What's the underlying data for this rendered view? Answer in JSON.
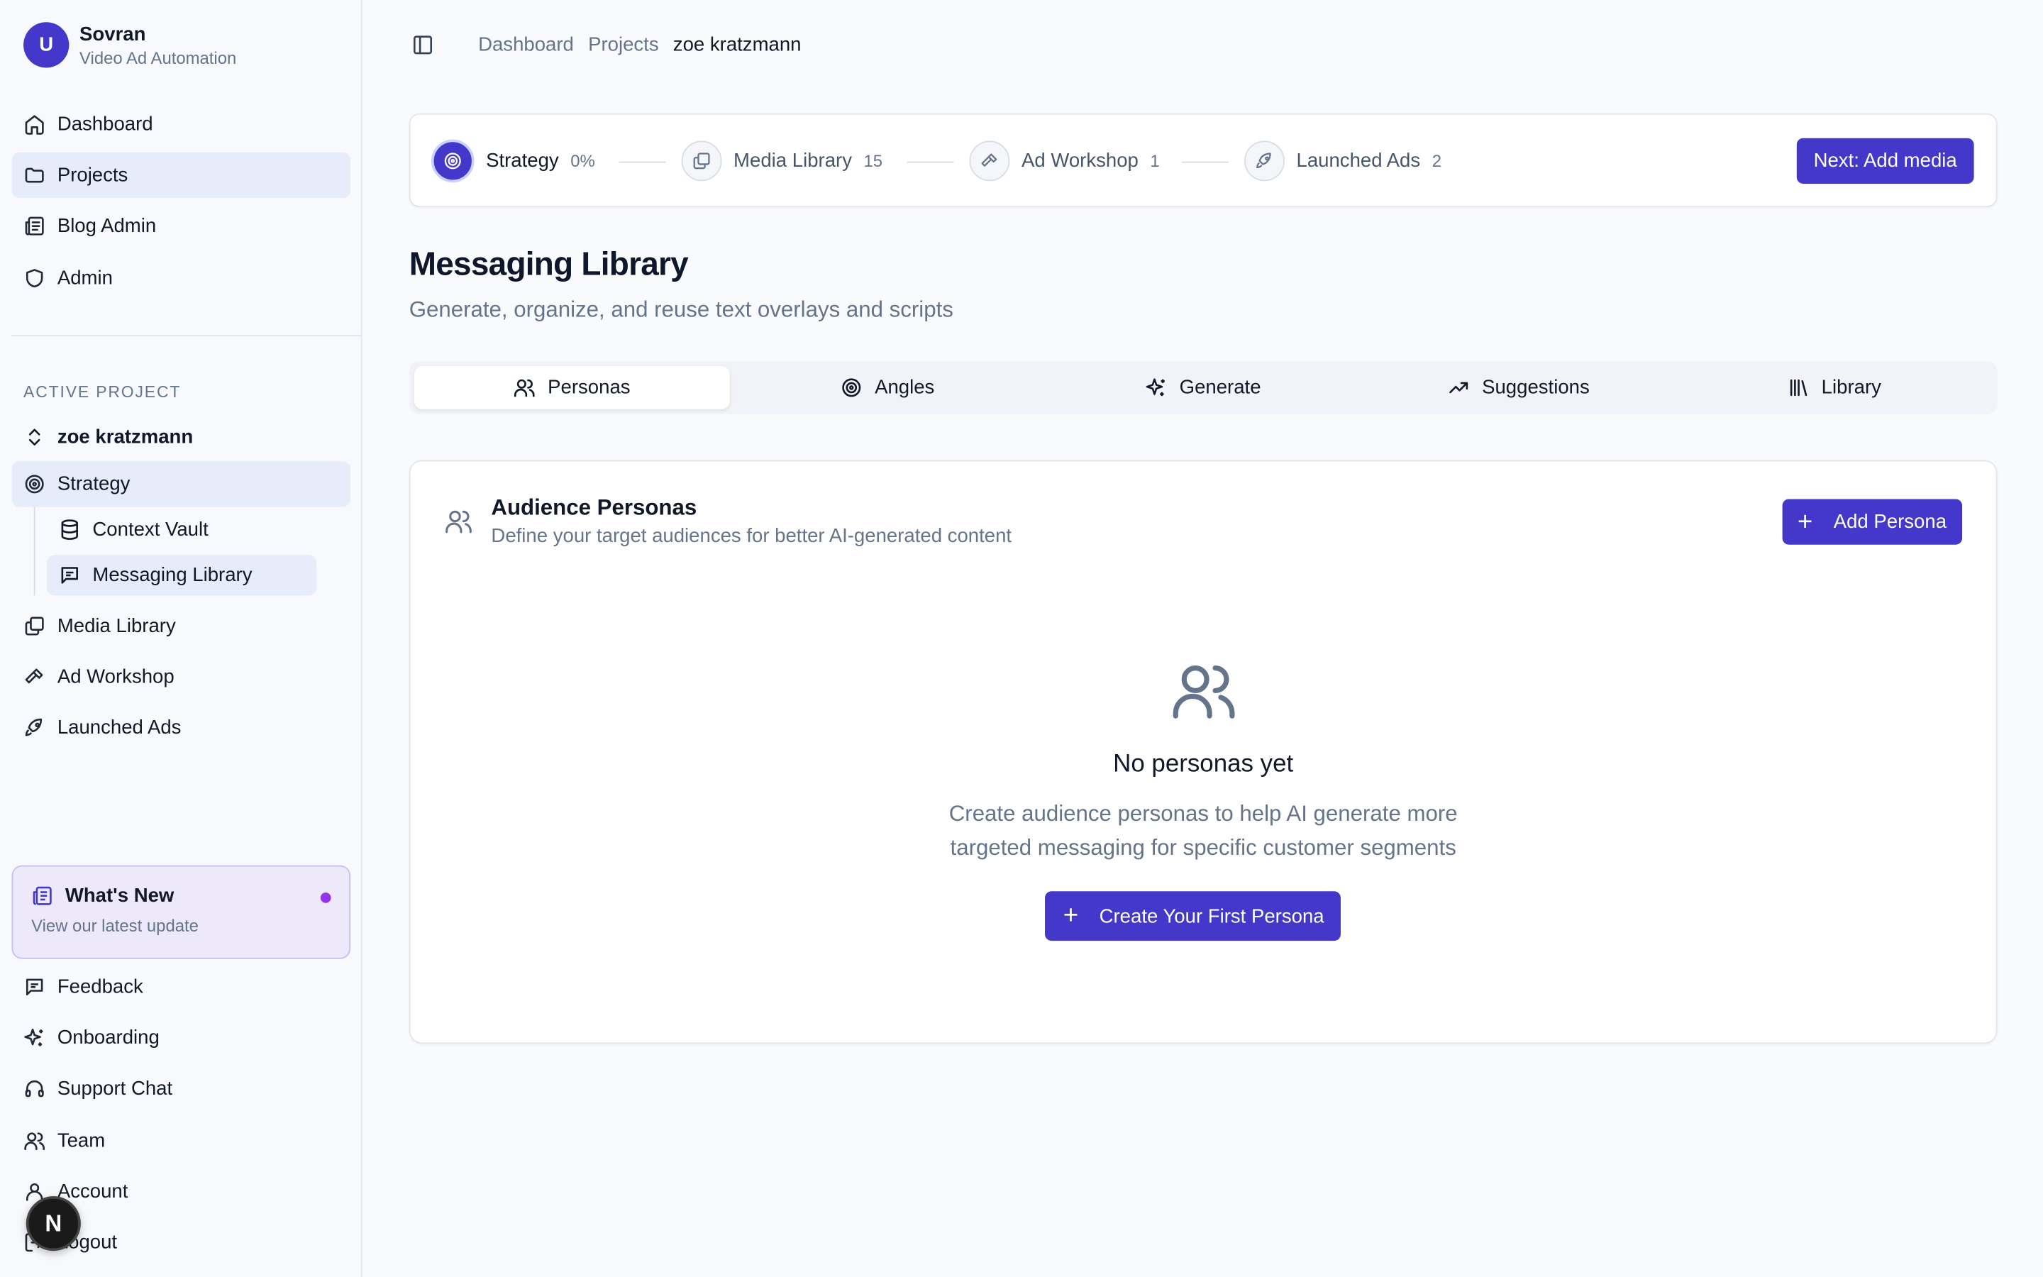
{
  "brand": {
    "initial": "U",
    "name": "Sovran",
    "subtitle": "Video Ad Automation"
  },
  "sidebar": {
    "main": [
      {
        "label": "Dashboard",
        "icon": "home-icon"
      },
      {
        "label": "Projects",
        "icon": "folder-icon",
        "active": true
      },
      {
        "label": "Blog Admin",
        "icon": "newspaper-icon"
      },
      {
        "label": "Admin",
        "icon": "shield-icon"
      }
    ],
    "section_label": "ACTIVE PROJECT",
    "project_name": "zoe kratzmann",
    "project_items": [
      {
        "label": "Strategy",
        "icon": "target-icon",
        "active": true
      },
      {
        "label": "Context Vault",
        "icon": "database-icon",
        "sub": true
      },
      {
        "label": "Messaging Library",
        "icon": "message-square-icon",
        "sub": true,
        "active": true
      },
      {
        "label": "Media Library",
        "icon": "images-icon"
      },
      {
        "label": "Ad Workshop",
        "icon": "hammer-icon"
      },
      {
        "label": "Launched Ads",
        "icon": "rocket-icon"
      }
    ],
    "whats_new": {
      "title": "What's New",
      "subtitle": "View our latest update"
    },
    "bottom": [
      {
        "label": "Feedback",
        "icon": "message-square-icon"
      },
      {
        "label": "Onboarding",
        "icon": "sparkles-icon"
      },
      {
        "label": "Support Chat",
        "icon": "headphones-icon"
      },
      {
        "label": "Team",
        "icon": "users-icon"
      },
      {
        "label": "Account",
        "icon": "user-icon"
      },
      {
        "label": "Logout",
        "icon": "logout-icon"
      }
    ],
    "n_badge": "N"
  },
  "breadcrumb": [
    "Dashboard",
    "Projects",
    "zoe kratzmann"
  ],
  "stepper": {
    "steps": [
      {
        "label": "Strategy",
        "count": "0%",
        "active": true
      },
      {
        "label": "Media Library",
        "count": "15"
      },
      {
        "label": "Ad Workshop",
        "count": "1"
      },
      {
        "label": "Launched Ads",
        "count": "2"
      }
    ],
    "next_label": "Next: Add media"
  },
  "page": {
    "title": "Messaging Library",
    "subtitle": "Generate, organize, and reuse text overlays and scripts"
  },
  "tabs": [
    {
      "label": "Personas",
      "active": true
    },
    {
      "label": "Angles"
    },
    {
      "label": "Generate"
    },
    {
      "label": "Suggestions"
    },
    {
      "label": "Library"
    }
  ],
  "card": {
    "title": "Audience Personas",
    "subtitle": "Define your target audiences for better AI-generated content",
    "add_label": "Add Persona",
    "empty_title": "No personas yet",
    "empty_line1": "Create audience personas to help AI generate more",
    "empty_line2": "targeted messaging for specific customer segments",
    "create_label": "Create Your First Persona"
  },
  "colors": {
    "accent": "#4338ca",
    "active_bg": "#e6ecf9",
    "whats_new_bg": "#ede9fb"
  }
}
